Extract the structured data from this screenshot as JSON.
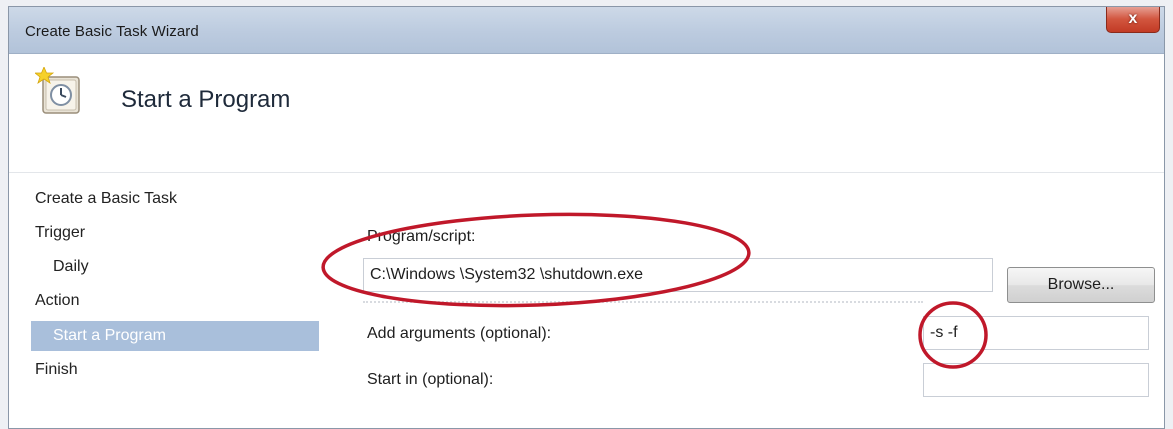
{
  "window": {
    "title": "Create Basic Task Wizard",
    "close_glyph": "x"
  },
  "header": {
    "title": "Start a Program",
    "icon": "task-scheduler-clock-icon"
  },
  "nav": {
    "items": [
      {
        "label": "Create a Basic Task",
        "indent": false,
        "selected": false
      },
      {
        "label": "Trigger",
        "indent": false,
        "selected": false
      },
      {
        "label": "Daily",
        "indent": true,
        "selected": false
      },
      {
        "label": "Action",
        "indent": false,
        "selected": false
      },
      {
        "label": "Start a Program",
        "indent": true,
        "selected": true
      },
      {
        "label": "Finish",
        "indent": false,
        "selected": false
      }
    ]
  },
  "form": {
    "program_label": "Program/script:",
    "program_value": "C:\\Windows \\System32 \\shutdown.exe",
    "browse_label": "Browse...",
    "args_label": "Add arguments (optional):",
    "args_value": "-s -f",
    "start_in_label": "Start in (optional):",
    "start_in_value": ""
  },
  "annotation": {
    "color": "#c0182a"
  }
}
